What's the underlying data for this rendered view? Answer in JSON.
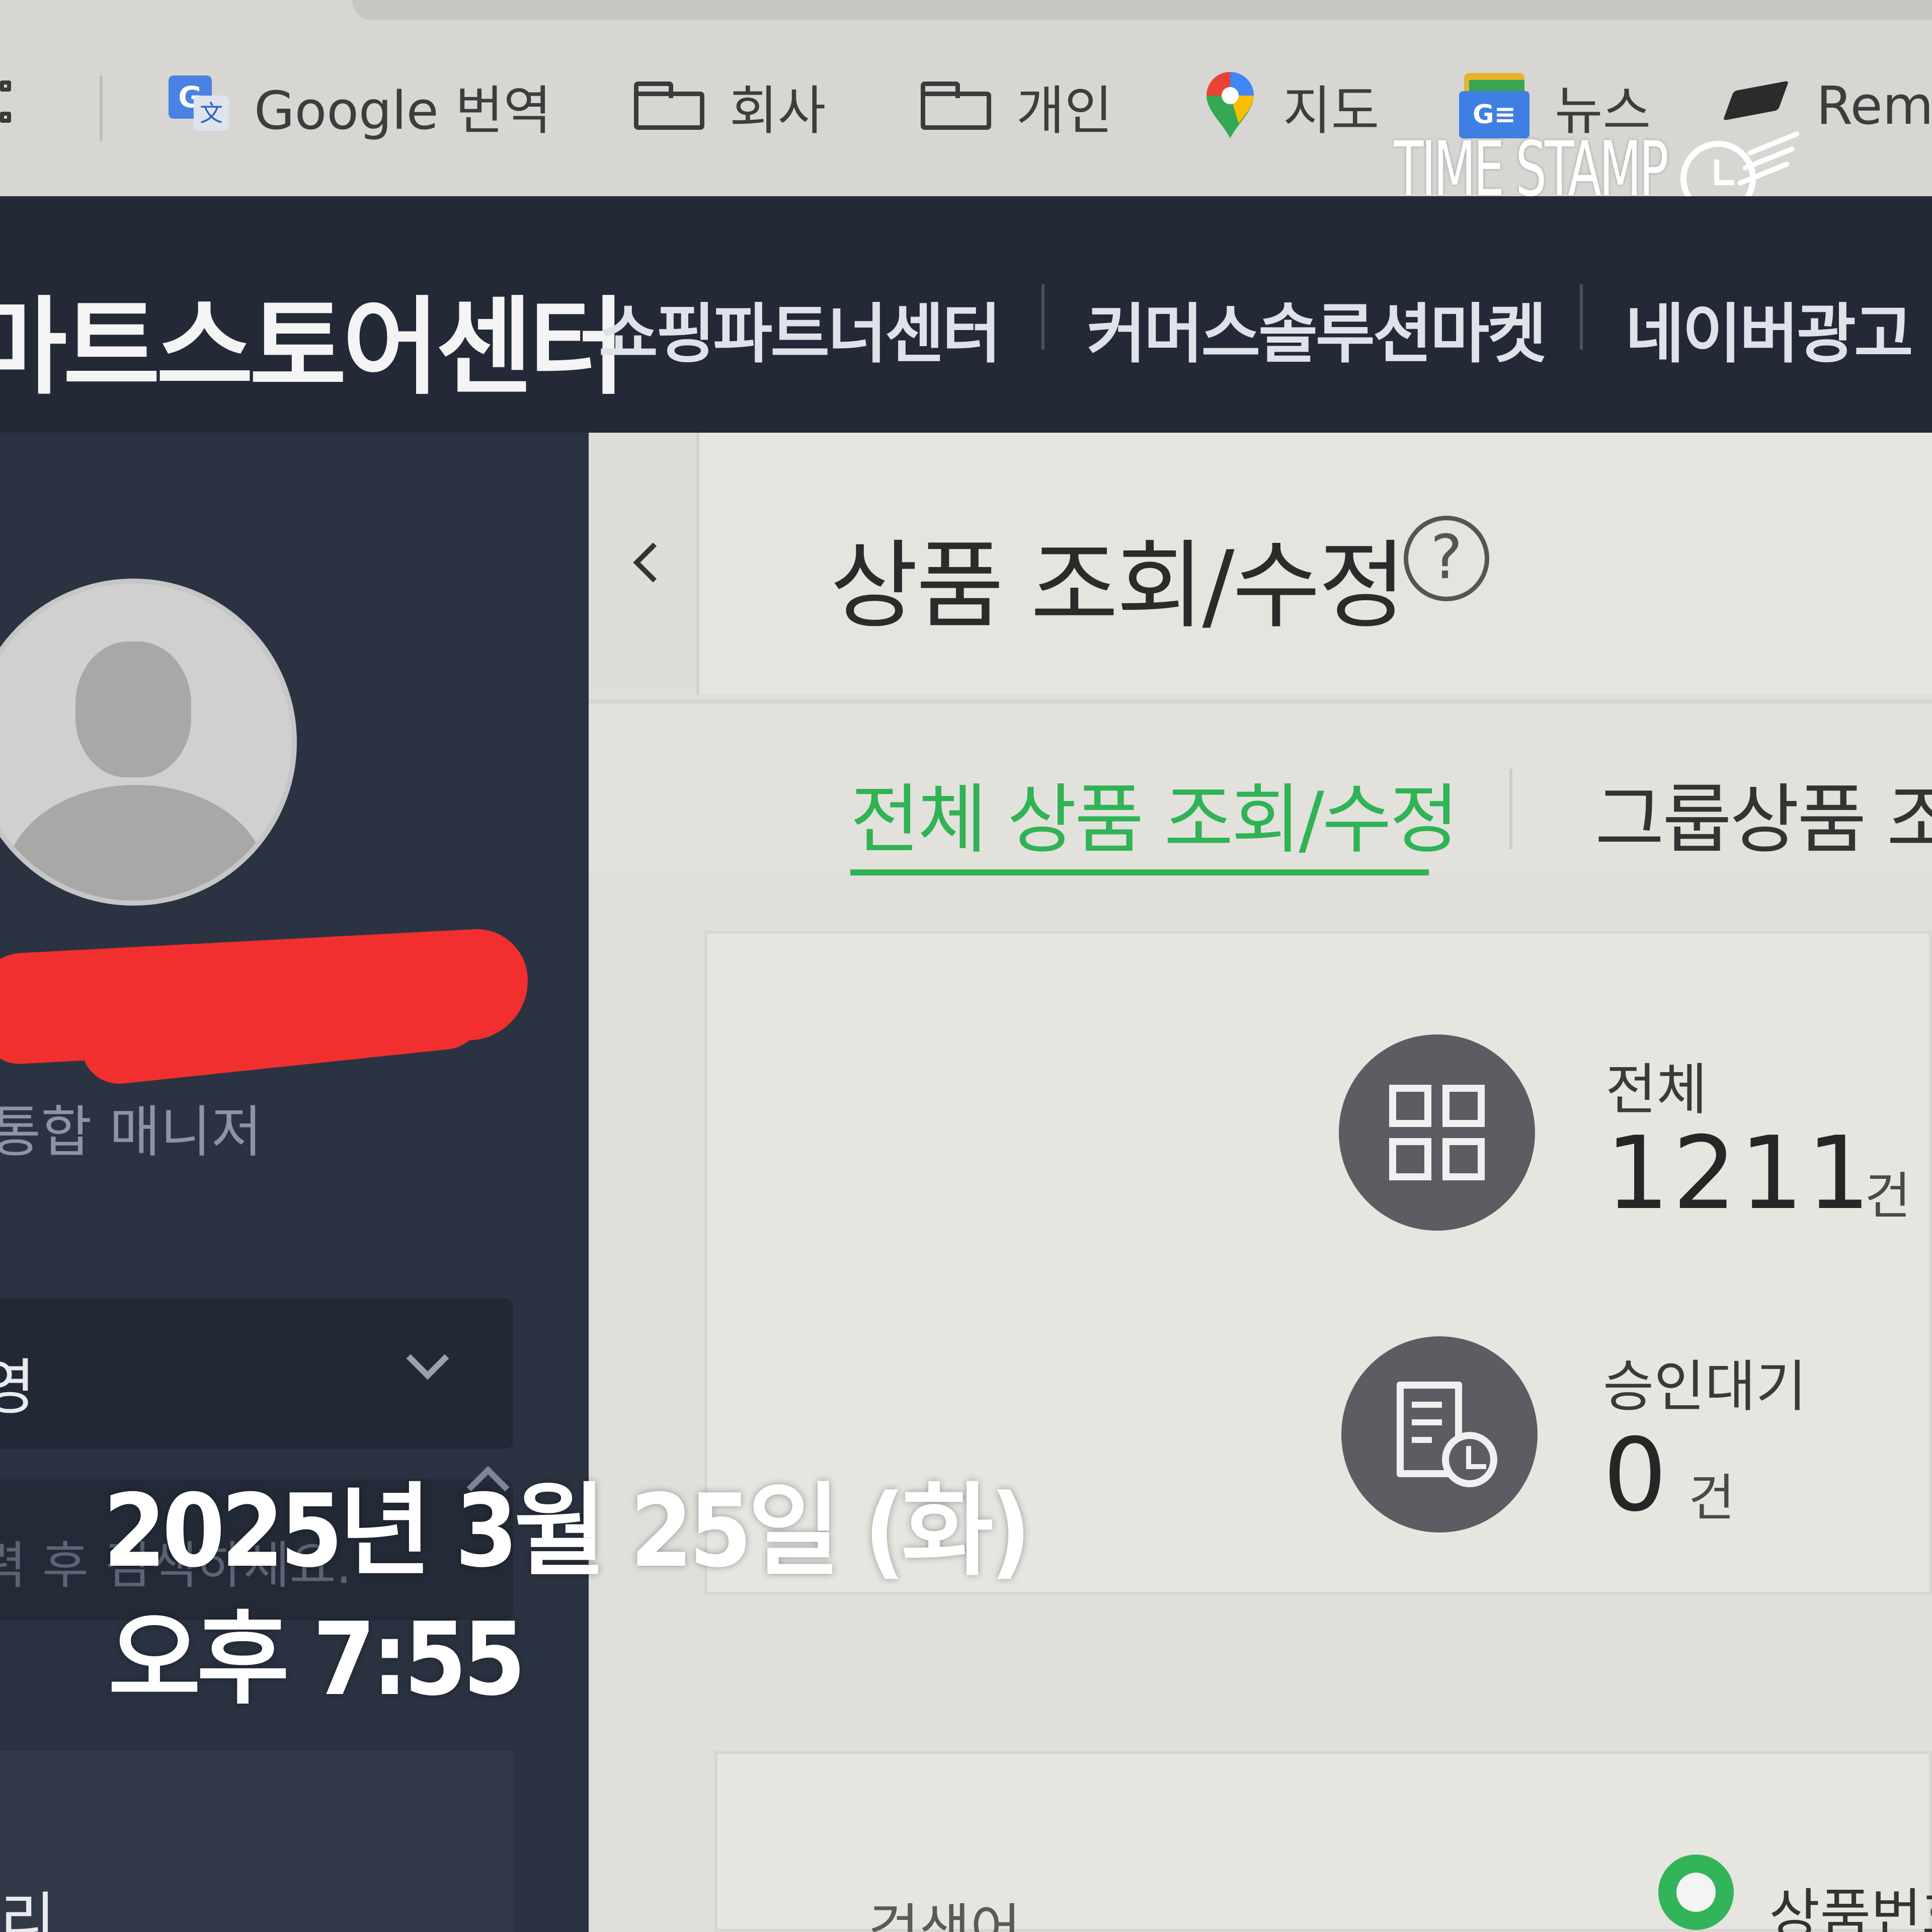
{
  "bookmarks": [
    {
      "label": "Google 번역",
      "icon": "google-translate-icon"
    },
    {
      "label": "회사",
      "icon": "folder-icon"
    },
    {
      "label": "개인",
      "icon": "folder-icon"
    },
    {
      "label": "지도",
      "icon": "google-maps-icon"
    },
    {
      "label": "뉴스",
      "icon": "google-news-icon"
    },
    {
      "label": "Remo",
      "icon": "remo-icon"
    }
  ],
  "watermark": {
    "logo": "TIME STAMP",
    "icon": "clock-icon"
  },
  "topnav": {
    "brand": "마트스토어센터",
    "links": [
      "쇼핑파트너센터",
      "커머스솔루션마켓",
      "네이버광고"
    ]
  },
  "sidebar": {
    "avatar_icon": "user-avatar-icon",
    "role": "통합 매니저",
    "menu_label": "영",
    "search_placeholder": "력 후 검색하세요.",
    "bottom_label": "리"
  },
  "main": {
    "page_title": "상품 조회/수정",
    "help_icon": "?",
    "tabs": [
      {
        "label": "전체 상품 조회/수정",
        "active": true
      },
      {
        "label": "그룹상품 조",
        "active": false
      }
    ],
    "stats": [
      {
        "label": "전체",
        "value": "1211",
        "unit": "건",
        "icon": "grid-icon"
      },
      {
        "label": "승인대기",
        "value": "0",
        "unit": "건",
        "icon": "document-clock-icon"
      }
    ],
    "search": {
      "label": "검색어",
      "radio_label": "상품번호"
    }
  },
  "photo_timestamp": {
    "date": "2025년 3월 25일 (화)",
    "time": "오후 7:55"
  },
  "colors": {
    "accent_green": "#2fb355",
    "header_dark": "#232936",
    "sidebar": "#2b3342",
    "redaction": "#f22f2f"
  }
}
